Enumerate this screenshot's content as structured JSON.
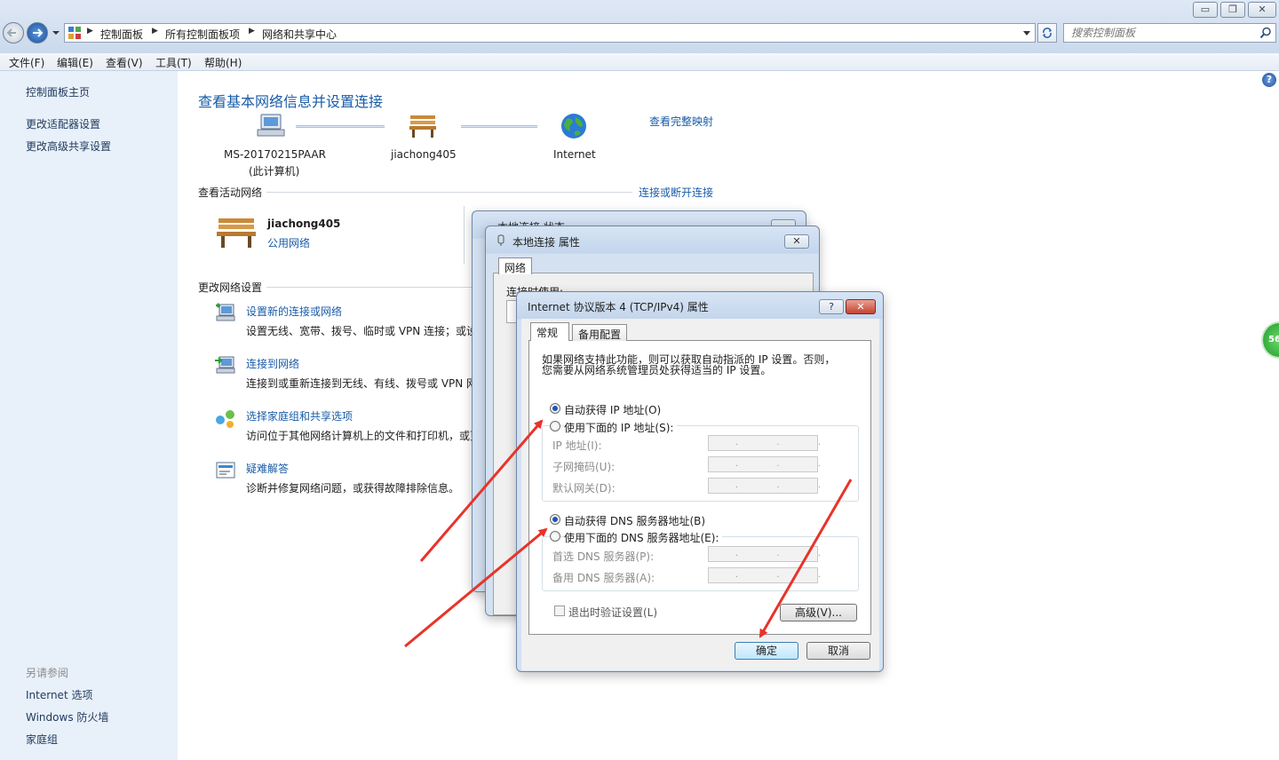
{
  "window": {
    "minimize_label": "▭",
    "restore_label": "❐",
    "close_label": "✕"
  },
  "breadcrumb": [
    "控制面板",
    "所有控制面板项",
    "网络和共享中心"
  ],
  "search": {
    "placeholder": "搜索控制面板"
  },
  "menubar": [
    "文件(F)",
    "编辑(E)",
    "查看(V)",
    "工具(T)",
    "帮助(H)"
  ],
  "sidebar": {
    "links": [
      "控制面板主页",
      "更改适配器设置",
      "更改高级共享设置"
    ],
    "see_also_title": "另请参阅",
    "see_also": [
      "Internet 选项",
      "Windows 防火墙",
      "家庭组"
    ]
  },
  "main": {
    "title": "查看基本网络信息并设置连接",
    "view_full_map": "查看完整映射",
    "nodes": [
      {
        "name": "MS-20170215PAAR",
        "sub": "(此计算机)",
        "icon": "computer-icon"
      },
      {
        "name": "jiachong405",
        "sub": "",
        "icon": "bench-icon"
      },
      {
        "name": "Internet",
        "sub": "",
        "icon": "globe-icon"
      }
    ],
    "active_networks_label": "查看活动网络",
    "connect_disconnect": "连接或断开连接",
    "active_network": {
      "name": "jiachong405",
      "type": "公用网络"
    },
    "change_settings_label": "更改网络设置",
    "tasks": [
      {
        "title": "设置新的连接或网络",
        "desc": "设置无线、宽带、拨号、临时或 VPN 连接；或设",
        "icon": "new-connection-icon"
      },
      {
        "title": "连接到网络",
        "desc": "连接到或重新连接到无线、有线、拨号或 VPN 网",
        "icon": "connect-network-icon"
      },
      {
        "title": "选择家庭组和共享选项",
        "desc": "访问位于其他网络计算机上的文件和打印机，或更",
        "icon": "homegroup-icon"
      },
      {
        "title": "疑难解答",
        "desc": "诊断并修复网络问题，或获得故障排除信息。",
        "icon": "troubleshoot-icon"
      }
    ]
  },
  "status_dialog": {
    "title": "本地连接 状态"
  },
  "props_dialog": {
    "title": "本地连接 属性",
    "tab": "网络",
    "connect_using": "连接时使用:"
  },
  "ipv4_dialog": {
    "title": "Internet 协议版本 4 (TCP/IPv4) 属性",
    "help_label": "?",
    "tabs": [
      "常规",
      "备用配置"
    ],
    "intro_line1": "如果网络支持此功能，则可以获取自动指派的 IP 设置。否则，",
    "intro_line2": "您需要从网络系统管理员处获得适当的 IP 设置。",
    "auto_ip": "自动获得 IP 地址(O)",
    "manual_ip": "使用下面的 IP 地址(S):",
    "ip_address_label": "IP 地址(I):",
    "subnet_label": "子网掩码(U):",
    "gateway_label": "默认网关(D):",
    "auto_dns": "自动获得 DNS 服务器地址(B)",
    "manual_dns": "使用下面的 DNS 服务器地址(E):",
    "preferred_dns_label": "首选 DNS 服务器(P):",
    "alternate_dns_label": "备用 DNS 服务器(A):",
    "ip_placeholder": ". . .",
    "validate_on_exit": "退出时验证设置(L)",
    "advanced_button": "高级(V)...",
    "ok_button": "确定",
    "cancel_button": "取消"
  },
  "floating_badge": "56",
  "colors": {
    "accent": "#1a5ca8",
    "arrow": "#e8332a",
    "sidebar_bg": "#e8f0fa"
  }
}
